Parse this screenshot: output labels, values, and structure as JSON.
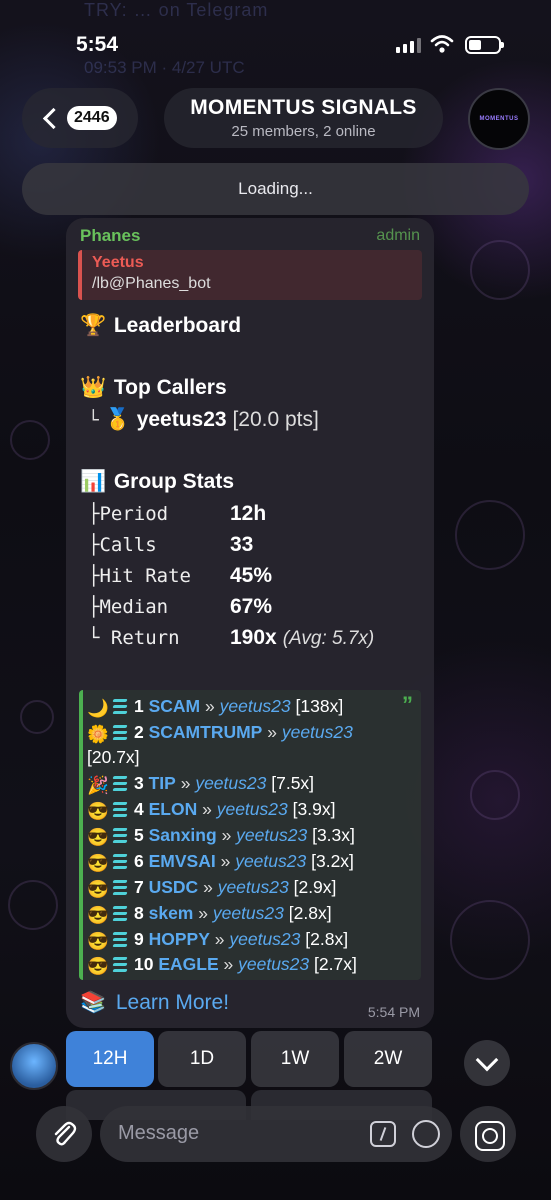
{
  "status_bar": {
    "time": "5:54"
  },
  "background_ghost": {
    "line1": "TRY: … on Telegram",
    "line2": "09:53 PM · 4/27 UTC"
  },
  "header": {
    "back_count": "2446",
    "title": "MOMENTUS SIGNALS",
    "subtitle": "25 members, 2 online",
    "avatar_text": "MOMENTUS"
  },
  "loading_text": "Loading...",
  "message": {
    "sender": "Phanes",
    "role": "admin",
    "reply": {
      "name": "Yeetus",
      "text": "/lb@Phanes_bot"
    },
    "leaderboard_title": "Leaderboard",
    "top_callers_title": "Top Callers",
    "top_caller": {
      "tree": "└",
      "name": "yeetus23",
      "points": "[20.0 pts]"
    },
    "group_stats_title": "Group Stats",
    "stats": [
      {
        "label": "├Period",
        "value": "12h",
        "extra": ""
      },
      {
        "label": "├Calls",
        "value": "33",
        "extra": ""
      },
      {
        "label": "├Hit Rate",
        "value": "45%",
        "extra": ""
      },
      {
        "label": "├Median",
        "value": "67%",
        "extra": ""
      },
      {
        "label": "└ Return",
        "value": "190x",
        "extra": "(Avg: 5.7x)"
      }
    ],
    "calls": [
      {
        "icon": "moon",
        "rank": "1",
        "ticker": "SCAM",
        "caller": "yeetus23",
        "mult": "[138x]"
      },
      {
        "icon": "pinwheel",
        "rank": "2",
        "ticker": "SCAMTRUMP",
        "caller": "yeetus23",
        "mult": "[20.7x]"
      },
      {
        "icon": "party",
        "rank": "3",
        "ticker": "TIP",
        "caller": "yeetus23",
        "mult": "[7.5x]"
      },
      {
        "icon": "sunglasses",
        "rank": "4",
        "ticker": "ELON",
        "caller": "yeetus23",
        "mult": "[3.9x]"
      },
      {
        "icon": "sunglasses",
        "rank": "5",
        "ticker": "Sanxing",
        "caller": "yeetus23",
        "mult": "[3.3x]"
      },
      {
        "icon": "sunglasses",
        "rank": "6",
        "ticker": "EMVSAI",
        "caller": "yeetus23",
        "mult": "[3.2x]"
      },
      {
        "icon": "sunglasses",
        "rank": "7",
        "ticker": "USDC",
        "caller": "yeetus23",
        "mult": "[2.9x]"
      },
      {
        "icon": "sunglasses",
        "rank": "8",
        "ticker": "skem",
        "caller": "yeetus23",
        "mult": "[2.8x]"
      },
      {
        "icon": "sunglasses",
        "rank": "9",
        "ticker": "HOPPY",
        "caller": "yeetus23",
        "mult": "[2.8x]"
      },
      {
        "icon": "sunglasses",
        "rank": "10",
        "ticker": "EAGLE",
        "caller": "yeetus23",
        "mult": "[2.7x]"
      }
    ],
    "separator": "»",
    "learn_more": "Learn More!",
    "time": "5:54 PM"
  },
  "keyboard": [
    {
      "label": "12H",
      "active": true
    },
    {
      "label": "1D",
      "active": false
    },
    {
      "label": "1W",
      "active": false
    },
    {
      "label": "2W",
      "active": false
    }
  ],
  "input": {
    "placeholder": "Message"
  },
  "colors": {
    "accent": "#3f82d9",
    "sender": "#69c15c",
    "link": "#5aa9ef",
    "reply": "#ec5b55",
    "quote_bar": "#4cb050"
  }
}
